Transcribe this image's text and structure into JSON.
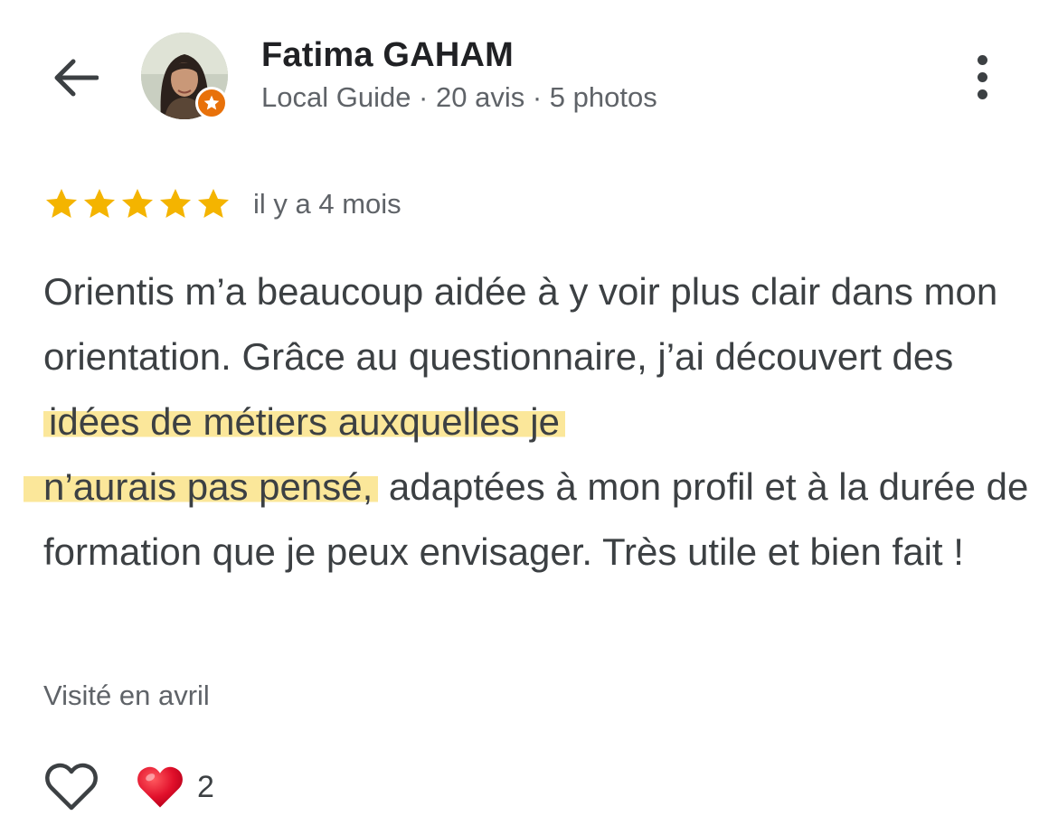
{
  "header": {
    "back_icon": "arrow-left-icon",
    "user_name": "Fatima GAHAM",
    "user_meta": "Local Guide · 20 avis · 5 photos",
    "more_icon": "more-vertical-icon",
    "badge_icon": "local-guide-star-icon"
  },
  "review": {
    "rating": 5,
    "rating_max": 5,
    "time_ago": "il y a 4 mois",
    "text_part1": "Orientis m’a beaucoup aidée à y voir plus clair dans mon orientation. Grâce au questionnaire, j’ai découvert des",
    "highlight_line1": "idées de métiers auxquelles je",
    "highlight_line2": "n’aurais pas pensé,",
    "text_part2": " adaptées à mon profil et à la durée de formation que je peux envisager. Très utile et bien fait !",
    "visited": "Visité en avril"
  },
  "actions": {
    "like_icon": "heart-outline-icon",
    "reaction_icon": "red-heart-icon",
    "reaction_count": "2"
  },
  "colors": {
    "star": "#f4b400",
    "highlight": "#fbe79a",
    "badge": "#e8710a",
    "heart": "#e1102b",
    "secondary_text": "#5f6368"
  }
}
